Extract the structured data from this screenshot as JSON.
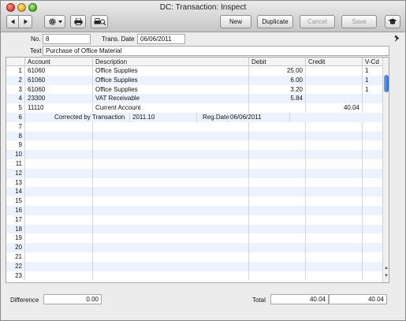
{
  "window": {
    "title": "DC: Transaction: Inspect"
  },
  "toolbar": {
    "new_label": "New",
    "duplicate_label": "Duplicate",
    "cancel_label": "Cancel",
    "save_label": "Save",
    "icons": [
      "back-arrow",
      "forward-arrow",
      "gear-menu",
      "print",
      "print-preview",
      "graduation-cap"
    ]
  },
  "header": {
    "no_label": "No.",
    "no_value": "8",
    "trans_date_label": "Trans. Date",
    "trans_date_value": "06/06/2011",
    "text_label": "Text",
    "text_value": "Purchase of Office Material"
  },
  "matrix": {
    "columns": [
      "Account",
      "Description",
      "Debit",
      "Credit",
      "V-Cd"
    ],
    "rows": [
      {
        "num": "1",
        "account": "61060",
        "description": "Office Supplies",
        "debit": "25.00",
        "credit": "",
        "vcd": "1"
      },
      {
        "num": "2",
        "account": "61060",
        "description": "Office Supplies",
        "debit": "6.00",
        "credit": "",
        "vcd": "1"
      },
      {
        "num": "3",
        "account": "61060",
        "description": "Office Supplies",
        "debit": "3.20",
        "credit": "",
        "vcd": "1"
      },
      {
        "num": "4",
        "account": "23300",
        "description": "VAT Receivable",
        "debit": "5.84",
        "credit": "",
        "vcd": ""
      },
      {
        "num": "5",
        "account": "11110",
        "description": "Current Account",
        "debit": "",
        "credit": "40.04",
        "vcd": ""
      }
    ],
    "subrow": {
      "num": "6",
      "corrected_label": "Corrected by Transaction",
      "corrected_value": "2011.10",
      "regdate_label": "Reg.Date",
      "regdate_value": "06/06/2011"
    },
    "empty_row_numbers": [
      "7",
      "8",
      "9",
      "10",
      "11",
      "12",
      "13",
      "14",
      "15",
      "16",
      "17",
      "18",
      "19",
      "20",
      "21",
      "22",
      "23"
    ]
  },
  "footer": {
    "difference_label": "Difference",
    "difference_value": "0.00",
    "total_label": "Total",
    "total_debit": "40.04",
    "total_credit": "40.04"
  }
}
